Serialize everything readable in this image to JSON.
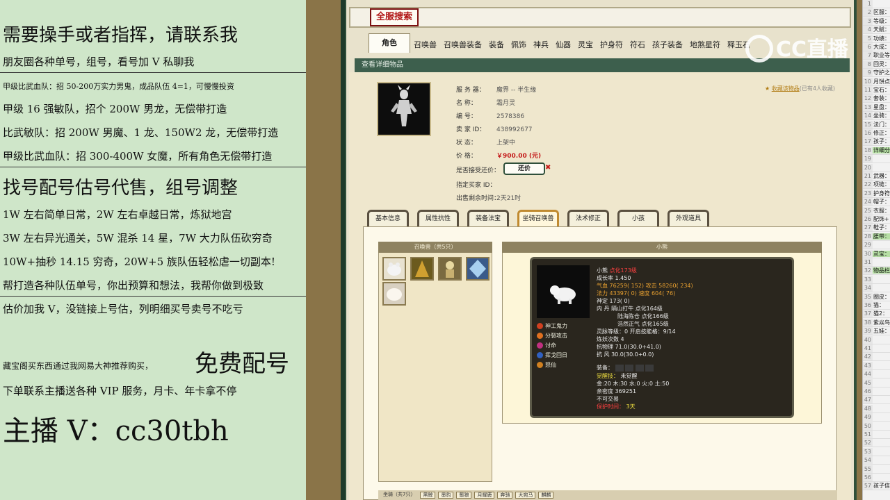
{
  "left_panel": {
    "lines": [
      "需要操手或者指挥，请联系我",
      "朋友圈各种单号，组号，看号加 V 私聊我",
      "甲级比武血队：招 50-200万实力男鬼，成品队伍 4=1，可慢慢投资",
      "甲级 16 强敏队，招个 200W 男龙，无偿带打造",
      "比武敏队：招 200W 男魔、1 龙、150W2 龙，无偿带打造",
      "甲级比武血队：招 300-400W 女魔，所有角色无偿带打造",
      "找号配号估号代售，组号调整",
      "1W 左右简单日常，2W 左右卓越日常，炼狱地宫",
      "3W 左右异光通关，5W 混杀 14 星，7W 大力队伍砍穷奇",
      "10W+抽秒 14.15 穷奇，20W+5 族队伍轻松虐一切副本!",
      "帮打造各种队伍单号，你出预算和想法，我帮你做到极致",
      "估价加我 V，没链接上号估，列明细买号卖号不吃亏",
      "藏宝阁买东西通过我网易大神推荐购买，",
      "免费配号",
      "下单联系主播送各种 VIP 服务，月卡、年卡拿不停",
      "主播 V：cc30tbh"
    ]
  },
  "game": {
    "title_badge": "全服搜索",
    "main_tabs": [
      "角色",
      "召唤兽",
      "召唤兽装备",
      "装备",
      "佩饰",
      "神兵",
      "仙器",
      "灵宝",
      "护身符",
      "符石",
      "孩子装备",
      "地煞星符",
      "释玉石"
    ],
    "section_title": "查看详细物品",
    "info": {
      "server_label": "服 务 器：",
      "server": "魔界 -- 半生缘",
      "name_label": "名        称：",
      "name": "霜月灵",
      "id_label": "编        号：",
      "id": "2578386",
      "seller_label": "卖  家  ID：",
      "seller": "438992677",
      "status_label": "状        态：",
      "status": "上架中",
      "price_label": "价        格：",
      "price": "￥900.00 (元)",
      "bargain_label": "是否接受还价：",
      "bargain_button": "还价",
      "bargain_x": "✖",
      "buyer_label": "指定买家 ID：",
      "buyer": "",
      "time_label": "出售剩余时间：",
      "time": "2天21时"
    },
    "fav": "收藏该物品",
    "fav_count": "(已有4人收藏)",
    "sub_tabs": [
      "基本信息",
      "属性抗性",
      "装备法宝",
      "坐骑召唤兽",
      "法术修正",
      "小孩",
      "外观道具"
    ],
    "summon_header": "召唤兽（共5只）",
    "pet_header": "小熊",
    "pet": {
      "name": "小熊",
      "evo": "点化173级",
      "growth": "成长率 1.450",
      "hp": "气血 76259( 152)",
      "atk": "攻击 58260( 234)",
      "mp": "法力 43397( 0)",
      "spd": "速度 604( 76)",
      "def": "神定 173( 0)",
      "inner1": "内  丹 隔山打牛 点化164级",
      "inner2": "陆海陈仓 点化166级",
      "inner3": "浩然正气 点化165级",
      "spirit": "灵脉等级：0 开启技能格：9/14",
      "refine": "炼妖次数 4",
      "resist1": "抗物理 71.0(30.0+41.0)",
      "resist2": "抗  风 30.0(30.0+0.0)",
      "equip": "装备：",
      "awake_label": "觉醒技：",
      "awake": "未觉醒",
      "elements": "金:20 木:30 水:0 火:0 土:50",
      "intimacy": "亲密度 369251",
      "trade": "不可交易",
      "protect_label": "保护时间：",
      "protect": "3天"
    },
    "skills": [
      "神工鬼力",
      "分裂攻击",
      "讨命",
      "挥戈回日",
      "怒仙"
    ],
    "bottom_tabs": [
      "坐骑（共7只）",
      "黑鲸",
      "墨豹",
      "鬃狼",
      "月耀鹿",
      "奔驰",
      "大宛马",
      "麒麟"
    ]
  },
  "watermark": "CC直播",
  "sheet": {
    "rows": [
      {
        "n": "1",
        "t": ""
      },
      {
        "n": "2",
        "t": "区服："
      },
      {
        "n": "3",
        "t": "等级："
      },
      {
        "n": "4",
        "t": "天赋："
      },
      {
        "n": "5",
        "t": "功绩："
      },
      {
        "n": "6",
        "t": "大成："
      },
      {
        "n": "7",
        "t": "职业等级"
      },
      {
        "n": "8",
        "t": "回灵："
      },
      {
        "n": "9",
        "t": "守护之"
      },
      {
        "n": "10",
        "t": "月饼点"
      },
      {
        "n": "11",
        "t": "宝石："
      },
      {
        "n": "12",
        "t": "套装："
      },
      {
        "n": "13",
        "t": "星盘："
      },
      {
        "n": "14",
        "t": "坐骑："
      },
      {
        "n": "15",
        "t": "法门："
      },
      {
        "n": "16",
        "t": "修正："
      },
      {
        "n": "17",
        "t": "孩子："
      },
      {
        "n": "18",
        "t": "详细分"
      },
      {
        "n": "19",
        "t": ""
      },
      {
        "n": "20",
        "t": ""
      },
      {
        "n": "21",
        "t": "武器："
      },
      {
        "n": "22",
        "t": "项链："
      },
      {
        "n": "23",
        "t": "护身符"
      },
      {
        "n": "24",
        "t": "帽子："
      },
      {
        "n": "25",
        "t": "衣服："
      },
      {
        "n": "26",
        "t": "配饰+"
      },
      {
        "n": "27",
        "t": "鞋子："
      },
      {
        "n": "28",
        "t": "腰带："
      },
      {
        "n": "29",
        "t": ""
      },
      {
        "n": "30",
        "t": "灵宝："
      },
      {
        "n": "31",
        "t": ""
      },
      {
        "n": "32",
        "t": "物品栏"
      },
      {
        "n": "33",
        "t": ""
      },
      {
        "n": "34",
        "t": ""
      },
      {
        "n": "35",
        "t": "圈皮："
      },
      {
        "n": "36",
        "t": "猫："
      },
      {
        "n": "37",
        "t": "猫2："
      },
      {
        "n": "38",
        "t": "紫焱鸟"
      },
      {
        "n": "39",
        "t": "五娃："
      },
      {
        "n": "40",
        "t": ""
      },
      {
        "n": "41",
        "t": ""
      },
      {
        "n": "42",
        "t": ""
      },
      {
        "n": "43",
        "t": ""
      },
      {
        "n": "44",
        "t": ""
      },
      {
        "n": "45",
        "t": ""
      },
      {
        "n": "46",
        "t": ""
      },
      {
        "n": "47",
        "t": ""
      },
      {
        "n": "48",
        "t": ""
      },
      {
        "n": "49",
        "t": ""
      },
      {
        "n": "50",
        "t": ""
      },
      {
        "n": "51",
        "t": ""
      },
      {
        "n": "52",
        "t": ""
      },
      {
        "n": "53",
        "t": ""
      },
      {
        "n": "54",
        "t": ""
      },
      {
        "n": "55",
        "t": ""
      },
      {
        "n": "56",
        "t": ""
      },
      {
        "n": "57",
        "t": "孩子信"
      }
    ]
  },
  "colors": {
    "left_bg": "#cfe6c9",
    "frame_green": "#2f4f3a",
    "price_red": "#c41a1a",
    "card_bg": "#2a261e"
  }
}
